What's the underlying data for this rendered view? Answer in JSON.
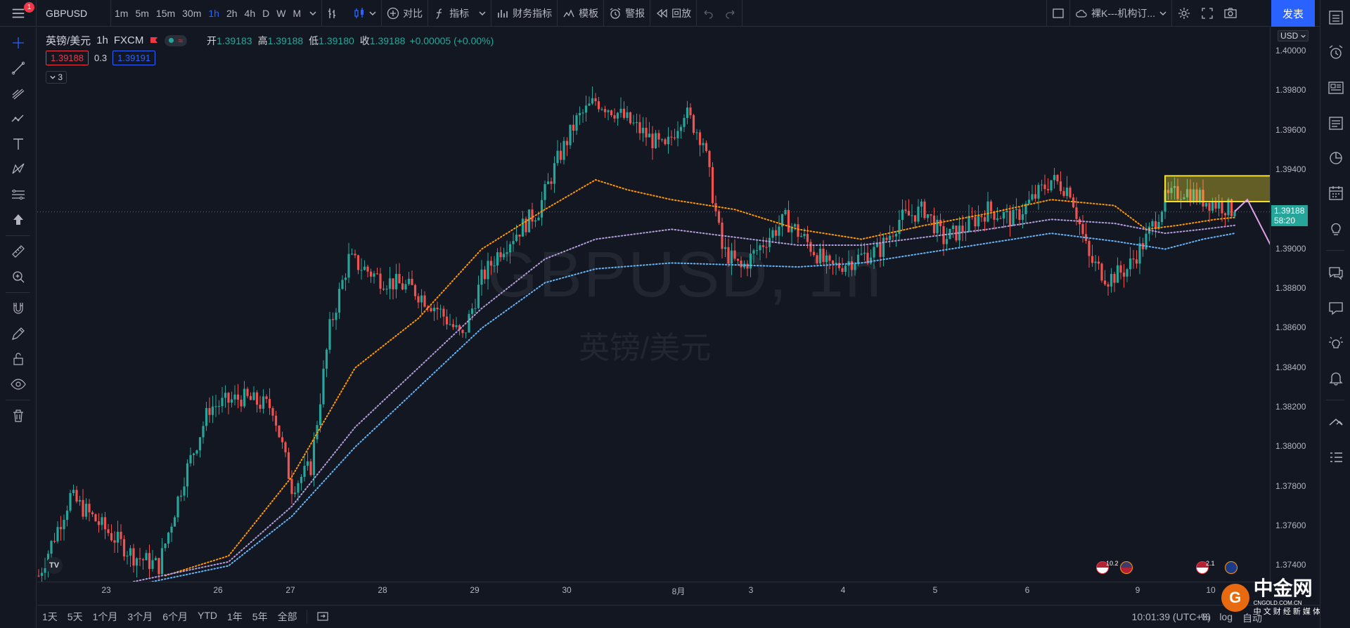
{
  "topbar": {
    "notification_count": "1",
    "symbol": "GBPUSD",
    "intervals": [
      "1m",
      "5m",
      "15m",
      "30m",
      "1h",
      "2h",
      "4h",
      "D",
      "W",
      "M"
    ],
    "active_interval": "1h",
    "compare": "对比",
    "indicators": "指标",
    "financials": "财务指标",
    "templates": "模板",
    "alerts": "警报",
    "replay": "回放",
    "layout_name": "裸K---机构订...",
    "publish": "发表"
  },
  "legend": {
    "title": "英镑/美元",
    "interval": "1h",
    "exchange": "FXCM",
    "open_label": "开",
    "open": "1.39183",
    "high_label": "高",
    "high": "1.39188",
    "low_label": "低",
    "low": "1.39180",
    "close_label": "收",
    "close": "1.39188",
    "change": "+0.00005 (+0.00%)",
    "sell_price": "1.39188",
    "spread": "0.3",
    "buy_price": "1.39191",
    "indicators_count": "3"
  },
  "watermark": {
    "symbol": "GBPUSD, 1h",
    "name": "英镑/美元"
  },
  "price_axis": {
    "currency": "USD",
    "ticks": [
      "1.40000",
      "1.39800",
      "1.39600",
      "1.39400",
      "1.39200",
      "1.39000",
      "1.38800",
      "1.38600",
      "1.38400",
      "1.38200",
      "1.38000",
      "1.37800",
      "1.37600",
      "1.37400"
    ],
    "current_price": "1.39188",
    "countdown": "58:20"
  },
  "date_axis": [
    "23",
    "26",
    "27",
    "28",
    "29",
    "30",
    "8月",
    "3",
    "4",
    "5",
    "6",
    "9",
    "10"
  ],
  "event_badges": [
    "10.2",
    "2.1"
  ],
  "bottombar": {
    "ranges": [
      "1天",
      "5天",
      "1个月",
      "3个月",
      "6个月",
      "YTD",
      "1年",
      "5年",
      "全部"
    ],
    "time": "10:01:39 (UTC+8)",
    "right_labels": [
      "%",
      "log",
      "自动"
    ]
  },
  "brand": {
    "name": "中金网",
    "url": "CNGOLD.COM.CN",
    "media": "中 文 财 经 新 媒 体"
  },
  "colors": {
    "up": "#26a69a",
    "down": "#ef5350",
    "accent": "#2962ff",
    "ma1": "#ff9800",
    "ma2": "#b39ddb",
    "ma3": "#64b5f6",
    "zone": "#f5e12a",
    "projection": "#e1a1e8"
  },
  "chart_data": {
    "type": "candlestick",
    "symbol": "GBPUSD",
    "interval": "1h",
    "ylim": [
      1.3732,
      1.4012
    ],
    "x_labels": [
      "23",
      "26",
      "27",
      "28",
      "29",
      "30",
      "8月",
      "3",
      "4",
      "5",
      "6",
      "9",
      "10"
    ],
    "current_price": 1.39188,
    "anchors": [
      [
        0,
        1.3735
      ],
      [
        10,
        1.3775
      ],
      [
        20,
        1.376
      ],
      [
        30,
        1.3745
      ],
      [
        38,
        1.374
      ],
      [
        46,
        1.3785
      ],
      [
        54,
        1.382
      ],
      [
        64,
        1.3825
      ],
      [
        74,
        1.382
      ],
      [
        80,
        1.378
      ],
      [
        86,
        1.379
      ],
      [
        92,
        1.386
      ],
      [
        98,
        1.3895
      ],
      [
        108,
        1.3885
      ],
      [
        118,
        1.388
      ],
      [
        126,
        1.387
      ],
      [
        134,
        1.3855
      ],
      [
        140,
        1.3885
      ],
      [
        146,
        1.39
      ],
      [
        152,
        1.391
      ],
      [
        158,
        1.392
      ],
      [
        164,
        1.3945
      ],
      [
        170,
        1.3965
      ],
      [
        176,
        1.3975
      ],
      [
        182,
        1.397
      ],
      [
        190,
        1.396
      ],
      [
        198,
        1.395
      ],
      [
        204,
        1.397
      ],
      [
        210,
        1.3955
      ],
      [
        216,
        1.39
      ],
      [
        222,
        1.389
      ],
      [
        230,
        1.3905
      ],
      [
        236,
        1.3915
      ],
      [
        242,
        1.3905
      ],
      [
        250,
        1.389
      ],
      [
        258,
        1.3895
      ],
      [
        266,
        1.39
      ],
      [
        272,
        1.3915
      ],
      [
        280,
        1.392
      ],
      [
        286,
        1.3905
      ],
      [
        292,
        1.391
      ],
      [
        300,
        1.392
      ],
      [
        308,
        1.3915
      ],
      [
        314,
        1.3925
      ],
      [
        320,
        1.3935
      ],
      [
        326,
        1.393
      ],
      [
        332,
        1.3895
      ],
      [
        338,
        1.3885
      ],
      [
        344,
        1.389
      ],
      [
        350,
        1.3905
      ],
      [
        356,
        1.3925
      ],
      [
        362,
        1.393
      ],
      [
        368,
        1.3925
      ],
      [
        374,
        1.3922
      ],
      [
        378,
        1.3919
      ]
    ],
    "series": [
      {
        "name": "ma1",
        "color": "#ff9800",
        "points": [
          [
            40,
            1.3735
          ],
          [
            60,
            1.3745
          ],
          [
            80,
            1.3785
          ],
          [
            100,
            1.384
          ],
          [
            120,
            1.3865
          ],
          [
            140,
            1.39
          ],
          [
            160,
            1.392
          ],
          [
            176,
            1.3935
          ],
          [
            186,
            1.393
          ],
          [
            200,
            1.3925
          ],
          [
            220,
            1.392
          ],
          [
            240,
            1.391
          ],
          [
            260,
            1.3905
          ],
          [
            280,
            1.3912
          ],
          [
            300,
            1.3918
          ],
          [
            320,
            1.3925
          ],
          [
            340,
            1.3922
          ],
          [
            350,
            1.391
          ],
          [
            360,
            1.3912
          ],
          [
            372,
            1.3915
          ],
          [
            378,
            1.3916
          ]
        ]
      },
      {
        "name": "ma2",
        "color": "#b39ddb",
        "points": [
          [
            30,
            1.3732
          ],
          [
            60,
            1.3742
          ],
          [
            80,
            1.377
          ],
          [
            100,
            1.381
          ],
          [
            120,
            1.384
          ],
          [
            140,
            1.387
          ],
          [
            160,
            1.3895
          ],
          [
            176,
            1.3905
          ],
          [
            200,
            1.391
          ],
          [
            220,
            1.3906
          ],
          [
            240,
            1.3902
          ],
          [
            260,
            1.3902
          ],
          [
            280,
            1.3906
          ],
          [
            300,
            1.391
          ],
          [
            320,
            1.3915
          ],
          [
            340,
            1.3913
          ],
          [
            356,
            1.3908
          ],
          [
            368,
            1.391
          ],
          [
            378,
            1.3912
          ]
        ]
      },
      {
        "name": "ma3",
        "color": "#64b5f6",
        "points": [
          [
            30,
            1.373
          ],
          [
            60,
            1.374
          ],
          [
            80,
            1.3765
          ],
          [
            100,
            1.38
          ],
          [
            120,
            1.383
          ],
          [
            140,
            1.386
          ],
          [
            160,
            1.3883
          ],
          [
            176,
            1.389
          ],
          [
            200,
            1.3893
          ],
          [
            220,
            1.3892
          ],
          [
            240,
            1.3891
          ],
          [
            260,
            1.3893
          ],
          [
            280,
            1.3898
          ],
          [
            300,
            1.3903
          ],
          [
            320,
            1.3908
          ],
          [
            340,
            1.3904
          ],
          [
            356,
            1.39
          ],
          [
            368,
            1.3905
          ],
          [
            378,
            1.3908
          ]
        ]
      }
    ],
    "zone": {
      "x0": 356,
      "x1": 418,
      "y0": 1.3924,
      "y1": 1.3937
    },
    "projection": [
      [
        378,
        1.3919
      ],
      [
        382,
        1.3925
      ],
      [
        398,
        1.3875
      ],
      [
        409,
        1.3894
      ],
      [
        427,
        1.3827
      ]
    ]
  }
}
